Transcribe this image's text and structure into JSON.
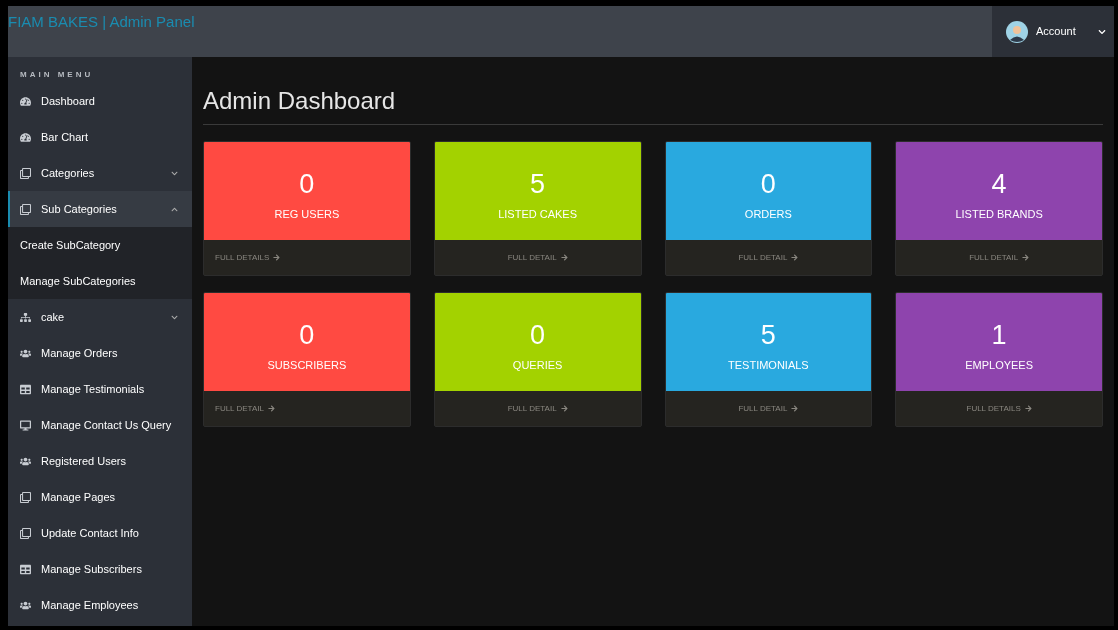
{
  "header": {
    "brand": "FIAM BAKES | Admin Panel",
    "account": "Account"
  },
  "sidebar": {
    "heading": "MAIN MENU",
    "items": [
      {
        "label": "Dashboard",
        "selected": false
      },
      {
        "label": "Bar Chart",
        "selected": false
      },
      {
        "label": "Categories",
        "selected": false,
        "expanded": false
      },
      {
        "label": "Sub Categories",
        "selected": true,
        "expanded": true,
        "children": [
          {
            "label": "Create SubCategory"
          },
          {
            "label": "Manage SubCategories"
          }
        ]
      },
      {
        "label": "cake",
        "selected": false,
        "expanded": false
      },
      {
        "label": "Manage Orders",
        "selected": false
      },
      {
        "label": "Manage Testimonials",
        "selected": false
      },
      {
        "label": "Manage Contact Us Query",
        "selected": false
      },
      {
        "label": "Registered Users",
        "selected": false
      },
      {
        "label": "Manage Pages",
        "selected": false
      },
      {
        "label": "Update Contact Info",
        "selected": false
      },
      {
        "label": "Manage Subscribers",
        "selected": false
      },
      {
        "label": "Manage Employees",
        "selected": false
      }
    ]
  },
  "main": {
    "title": "Admin Dashboard",
    "cards": [
      {
        "value": "0",
        "label": "REG USERS",
        "link": "FULL DETAILS",
        "color": "#ff4a42"
      },
      {
        "value": "5",
        "label": "LISTED CAKES",
        "link": "FULL DETAIL",
        "color": "#a3d200"
      },
      {
        "value": "0",
        "label": "ORDERS",
        "link": "FULL DETAIL",
        "color": "#29a9df"
      },
      {
        "value": "4",
        "label": "LISTED BRANDS",
        "link": "FULL DETAIL",
        "color": "#8e44ad"
      },
      {
        "value": "0",
        "label": "SUBSCRIBERS",
        "link": "FULL DETAIL",
        "color": "#ff4a42"
      },
      {
        "value": "0",
        "label": "QUERIES",
        "link": "FULL DETAIL",
        "color": "#a3d200"
      },
      {
        "value": "5",
        "label": "TESTIMONIALS",
        "link": "FULL DETAIL",
        "color": "#29a9df"
      },
      {
        "value": "1",
        "label": "EMPLOYEES",
        "link": "FULL DETAILS",
        "color": "#8e44ad"
      }
    ]
  }
}
